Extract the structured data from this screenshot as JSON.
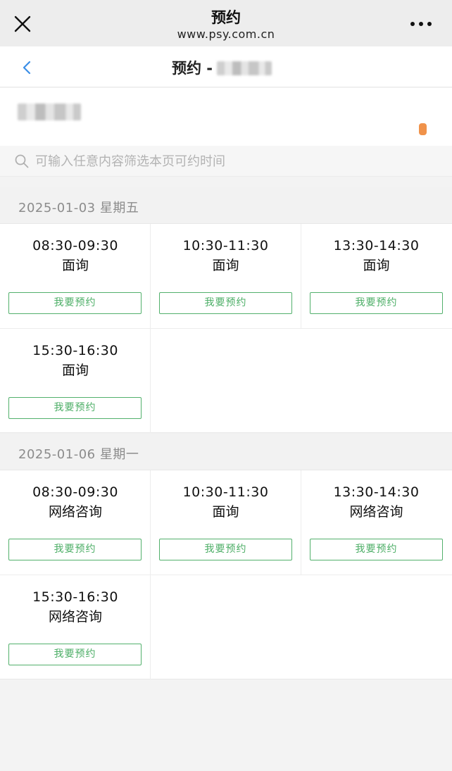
{
  "browser": {
    "title": "预约",
    "url": "www.psy.com.cn"
  },
  "header": {
    "title_prefix": "预约 -"
  },
  "search": {
    "placeholder": "可输入任意内容筛选本页可约时间"
  },
  "colors": {
    "accent_green": "#4cae66",
    "status_orange": "#f0924a",
    "back_blue": "#3a8ee6"
  },
  "days": [
    {
      "date": "2025-01-03 星期五",
      "slots": [
        {
          "time": "08:30-09:30",
          "type": "面询",
          "button": "我要预约"
        },
        {
          "time": "10:30-11:30",
          "type": "面询",
          "button": "我要预约"
        },
        {
          "time": "13:30-14:30",
          "type": "面询",
          "button": "我要预约"
        },
        {
          "time": "15:30-16:30",
          "type": "面询",
          "button": "我要预约"
        }
      ]
    },
    {
      "date": "2025-01-06 星期一",
      "slots": [
        {
          "time": "08:30-09:30",
          "type": "网络咨询",
          "button": "我要预约"
        },
        {
          "time": "10:30-11:30",
          "type": "面询",
          "button": "我要预约"
        },
        {
          "time": "13:30-14:30",
          "type": "网络咨询",
          "button": "我要预约"
        },
        {
          "time": "15:30-16:30",
          "type": "网络咨询",
          "button": "我要预约"
        }
      ]
    }
  ]
}
